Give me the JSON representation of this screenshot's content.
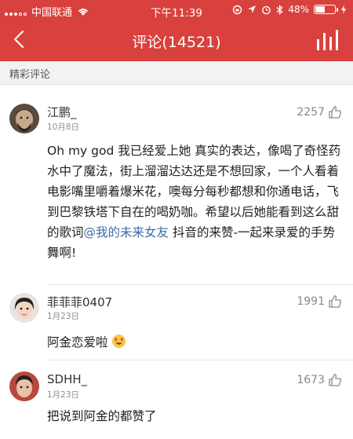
{
  "status_bar": {
    "carrier": "中国联通",
    "time": "下午11:39",
    "battery": "48%",
    "battery_level": 0.48
  },
  "nav": {
    "title": "评论(14521)"
  },
  "section": {
    "title": "精彩评论"
  },
  "comments": [
    {
      "name": "江鹏_",
      "date": "10月8日",
      "likes": "2257",
      "text_before": "Oh my god 我已经爱上她 真实的表达，像喝了奇怪药水中了魔法，街上溜溜达达还是不想回家，一个人看着电影嘴里嚼着爆米花，噢每分每秒都想和你通电话，飞到巴黎铁塔下自在的喝奶咖。希望以后她能看到这么甜的歌词",
      "mention": "@我的未来女友",
      "text_after": " 抖音的来赞-一起来录爱的手势舞啊!"
    },
    {
      "name": "菲菲菲0407",
      "date": "1月23日",
      "likes": "1991",
      "text": "阿金恋爱啦",
      "emoji": "heart-eyes"
    },
    {
      "name": "SDHH_",
      "date": "1月23日",
      "likes": "1673",
      "text": "把说到阿金的都赞了"
    }
  ],
  "colors": {
    "brand_red": "#d8413d",
    "mention_blue": "#3b6ea8",
    "meta_gray": "#8f8f8f"
  }
}
